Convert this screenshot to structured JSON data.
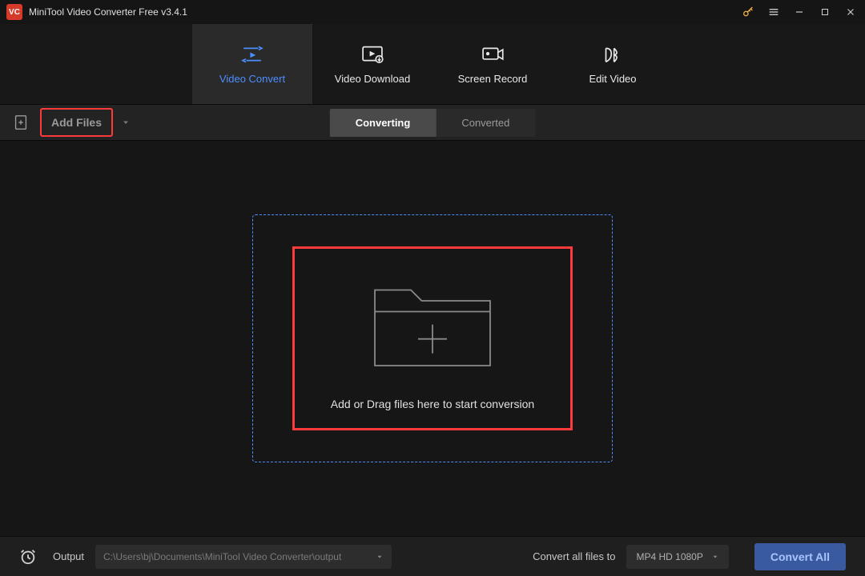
{
  "titlebar": {
    "app_title": "MiniTool Video Converter Free v3.4.1",
    "logo_text": "VC"
  },
  "main_tabs": {
    "video_convert": "Video Convert",
    "video_download": "Video Download",
    "screen_record": "Screen Record",
    "edit_video": "Edit Video"
  },
  "toolbar": {
    "add_files": "Add Files",
    "converting": "Converting",
    "converted": "Converted"
  },
  "dropzone": {
    "instruction": "Add or Drag files here to start conversion"
  },
  "footer": {
    "output_label": "Output",
    "output_path": "C:\\Users\\bj\\Documents\\MiniTool Video Converter\\output",
    "convert_all_to": "Convert all files to",
    "format": "MP4 HD 1080P",
    "convert_all": "Convert All"
  },
  "colors": {
    "accent_blue": "#4d8eff",
    "accent_red": "#ff3a3a",
    "accent_gold": "#f0b040"
  }
}
